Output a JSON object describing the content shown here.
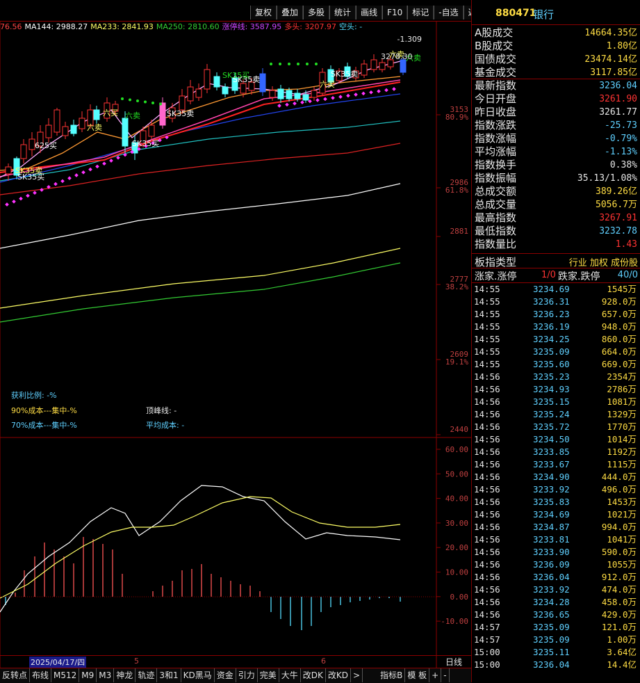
{
  "toolbar": {
    "buttons": [
      "复权",
      "叠加",
      "多股",
      "统计",
      "画线",
      "F10",
      "标记",
      "-自选",
      "返回"
    ]
  },
  "ma_legend": [
    {
      "text": "76.56",
      "color": "#ff4444"
    },
    {
      "text": "MA144: 2988.27",
      "color": "#ffffff"
    },
    {
      "text": "MA233: 2841.93",
      "color": "#ffff66"
    },
    {
      "text": "MA250: 2810.60",
      "color": "#33cc33"
    },
    {
      "text": "涨停线: 3587.95",
      "color": "#cc44ff"
    },
    {
      "text": "多头: 3207.97",
      "color": "#ff3333"
    },
    {
      "text": "空头: -",
      "color": "#55ddff"
    }
  ],
  "price_axis": {
    "labels": [
      {
        "v": "3153",
        "pct": "80.9%"
      },
      {
        "v": "2986",
        "pct": "61.8%"
      },
      {
        "v": "2881",
        "pct": ""
      },
      {
        "v": "2777",
        "pct": "38.2%"
      },
      {
        "v": "2609",
        "pct": "19.1%"
      },
      {
        "v": "2440",
        "pct": ""
      }
    ],
    "top_label": "-1.309"
  },
  "chart_annotations": {
    "peak_price": "3278.30",
    "signals": [
      "六卖",
      "SK35卖",
      "六买",
      "SK35卖",
      "六卖",
      "SK35卖",
      "625买",
      "SK35买",
      "六卖",
      "六买",
      "SK35买",
      "SK35卖",
      "SK35买",
      "六卖"
    ]
  },
  "chip_info": {
    "profit_ratio": "获利比例: -%",
    "cost90": "90%成本---集中-%",
    "cost70": "70%成本---集中-%",
    "peak_line": "顶峰线: -",
    "avg_cost": "平均成本: -"
  },
  "macd_axis": [
    "60.00",
    "50.00",
    "40.00",
    "30.00",
    "20.00",
    "10.00",
    "0.00",
    "-10.00"
  ],
  "date_axis": {
    "date": "2025/04/17/四",
    "m1": "5",
    "m2": "6",
    "period": "日线"
  },
  "bottom_tabs": [
    "反转点",
    "布线",
    "M512",
    "M9",
    "M3",
    "神龙",
    "轨迹",
    "3和1",
    "KD黑马",
    "资金",
    "引力",
    "完美",
    "大牛",
    "改DK",
    "改KD",
    ">",
    "指标B",
    "模 板",
    "+",
    "-"
  ],
  "header": {
    "code": "880471",
    "name": "银行"
  },
  "stats": [
    {
      "label": "A股成交",
      "value": "14664.35亿",
      "color": "#ffdd44"
    },
    {
      "label": "B股成交",
      "value": "1.80亿",
      "color": "#ffdd44"
    },
    {
      "label": "国债成交",
      "value": "23474.14亿",
      "color": "#ffdd44"
    },
    {
      "label": "基金成交",
      "value": "3117.85亿",
      "color": "#ffdd44"
    },
    {
      "label": "最新指数",
      "value": "3236.04",
      "color": "#5fd0ff"
    },
    {
      "label": "今日开盘",
      "value": "3261.90",
      "color": "#ff3333"
    },
    {
      "label": "昨日收盘",
      "value": "3261.77",
      "color": "#e8e8e8"
    },
    {
      "label": "指数涨跌",
      "value": "-25.73",
      "color": "#5fd0ff"
    },
    {
      "label": "指数涨幅",
      "value": "-0.79%",
      "color": "#5fd0ff"
    },
    {
      "label": "平均涨幅",
      "value": "-1.13%",
      "color": "#5fd0ff"
    },
    {
      "label": "指数换手",
      "value": "0.38%",
      "color": "#e8e8e8"
    },
    {
      "label": "指数振幅",
      "value": "35.13/1.08%",
      "color": "#e8e8e8"
    },
    {
      "label": "总成交额",
      "value": "389.26亿",
      "color": "#ffdd44"
    },
    {
      "label": "总成交量",
      "value": "5056.7万",
      "color": "#ffdd44"
    },
    {
      "label": "最高指数",
      "value": "3267.91",
      "color": "#ff3333"
    },
    {
      "label": "最低指数",
      "value": "3232.78",
      "color": "#5fd0ff"
    },
    {
      "label": "指数量比",
      "value": "1.43",
      "color": "#ff3333"
    }
  ],
  "board_type": {
    "label": "板指类型",
    "links": "行业 加权 成份股"
  },
  "advdecl": {
    "up_label": "涨家.涨停",
    "up": "1/0",
    "down_label": "跌家.跌停",
    "down": "40/0"
  },
  "ticks": [
    [
      "14:55",
      "3234.69",
      "1545万"
    ],
    [
      "14:55",
      "3236.31",
      "928.0万"
    ],
    [
      "14:55",
      "3236.23",
      "657.0万"
    ],
    [
      "14:55",
      "3236.19",
      "948.0万"
    ],
    [
      "14:55",
      "3234.25",
      "860.0万"
    ],
    [
      "14:55",
      "3235.09",
      "664.0万"
    ],
    [
      "14:55",
      "3235.60",
      "669.0万"
    ],
    [
      "14:56",
      "3235.23",
      "2354万"
    ],
    [
      "14:56",
      "3234.93",
      "2786万"
    ],
    [
      "14:56",
      "3235.15",
      "1081万"
    ],
    [
      "14:56",
      "3235.24",
      "1329万"
    ],
    [
      "14:56",
      "3235.72",
      "1770万"
    ],
    [
      "14:56",
      "3234.50",
      "1014万"
    ],
    [
      "14:56",
      "3233.85",
      "1192万"
    ],
    [
      "14:56",
      "3233.67",
      "1115万"
    ],
    [
      "14:56",
      "3234.90",
      "444.0万"
    ],
    [
      "14:56",
      "3233.92",
      "496.0万"
    ],
    [
      "14:56",
      "3235.83",
      "1453万"
    ],
    [
      "14:56",
      "3234.69",
      "1021万"
    ],
    [
      "14:56",
      "3234.87",
      "994.0万"
    ],
    [
      "14:56",
      "3233.81",
      "1041万"
    ],
    [
      "14:56",
      "3233.90",
      "590.0万"
    ],
    [
      "14:56",
      "3236.09",
      "1055万"
    ],
    [
      "14:56",
      "3236.04",
      "912.0万"
    ],
    [
      "14:56",
      "3233.92",
      "474.0万"
    ],
    [
      "14:56",
      "3234.28",
      "458.0万"
    ],
    [
      "14:56",
      "3236.65",
      "429.0万"
    ],
    [
      "14:57",
      "3235.09",
      "121.0万"
    ],
    [
      "14:57",
      "3235.09",
      "1.00万"
    ],
    [
      "15:00",
      "3235.11",
      "3.64亿"
    ],
    [
      "15:00",
      "3236.04",
      "14.4亿"
    ]
  ]
}
